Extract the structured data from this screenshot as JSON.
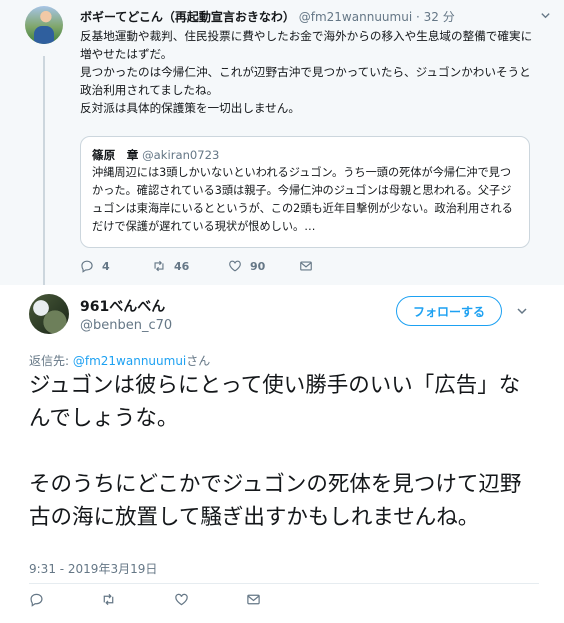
{
  "parent_tweet": {
    "display_name": "ボギーてどこん（再起動宣言おきなわ）",
    "handle": "@fm21wannuumui",
    "dot": "·",
    "time": "32 分",
    "lines": [
      "反基地運動や裁判、住民投票に費やしたお金で海外からの移入や生息域の整備で確実に増やせたはずだ。",
      "見つかったのは今帰仁沖、これが辺野古沖で見つかっていたら、ジュゴンかわいそうと政治利用されてましたね。",
      "反対派は具体的保護策を一切出しません。"
    ],
    "quote": {
      "display_name": "篠原　章",
      "handle": "@akiran0723",
      "text": "沖縄周辺には3頭しかいないといわれるジュゴン。うち一頭の死体が今帰仁沖で見つかった。確認されている3頭は親子。今帰仁沖のジュゴンは母親と思われる。父子ジュゴンは東海岸にいるとというが、この2頭も近年目撃例が少ない。政治利用されるだけで保護が遅れている現状が恨めしい。…"
    },
    "actions": {
      "reply_count": "4",
      "retweet_count": "46",
      "like_count": "90"
    }
  },
  "main_tweet": {
    "display_name": "961べんべん",
    "handle": "@benben_c70",
    "follow_label": "フォローする",
    "reply_to_prefix": "返信先: ",
    "reply_to_mention": "@fm21wannuumui",
    "reply_to_suffix": "さん",
    "paragraphs": [
      "ジュゴンは彼らにとって使い勝手のいい「広告」なんでしょうな。",
      "そのうちにどこかでジュゴンの死体を見つけて辺野古の海に放置して騒ぎ出すかもしれませんね。"
    ],
    "timestamp": "9:31 - 2019年3月19日"
  },
  "icons": {
    "reply": "reply-icon",
    "retweet": "retweet-icon",
    "like": "heart-icon",
    "message": "envelope-icon",
    "more": "chevron-down-icon"
  },
  "colors": {
    "accent": "#1da1f2",
    "secondary_text": "#657786",
    "parent_background": "#f5f8fa"
  }
}
